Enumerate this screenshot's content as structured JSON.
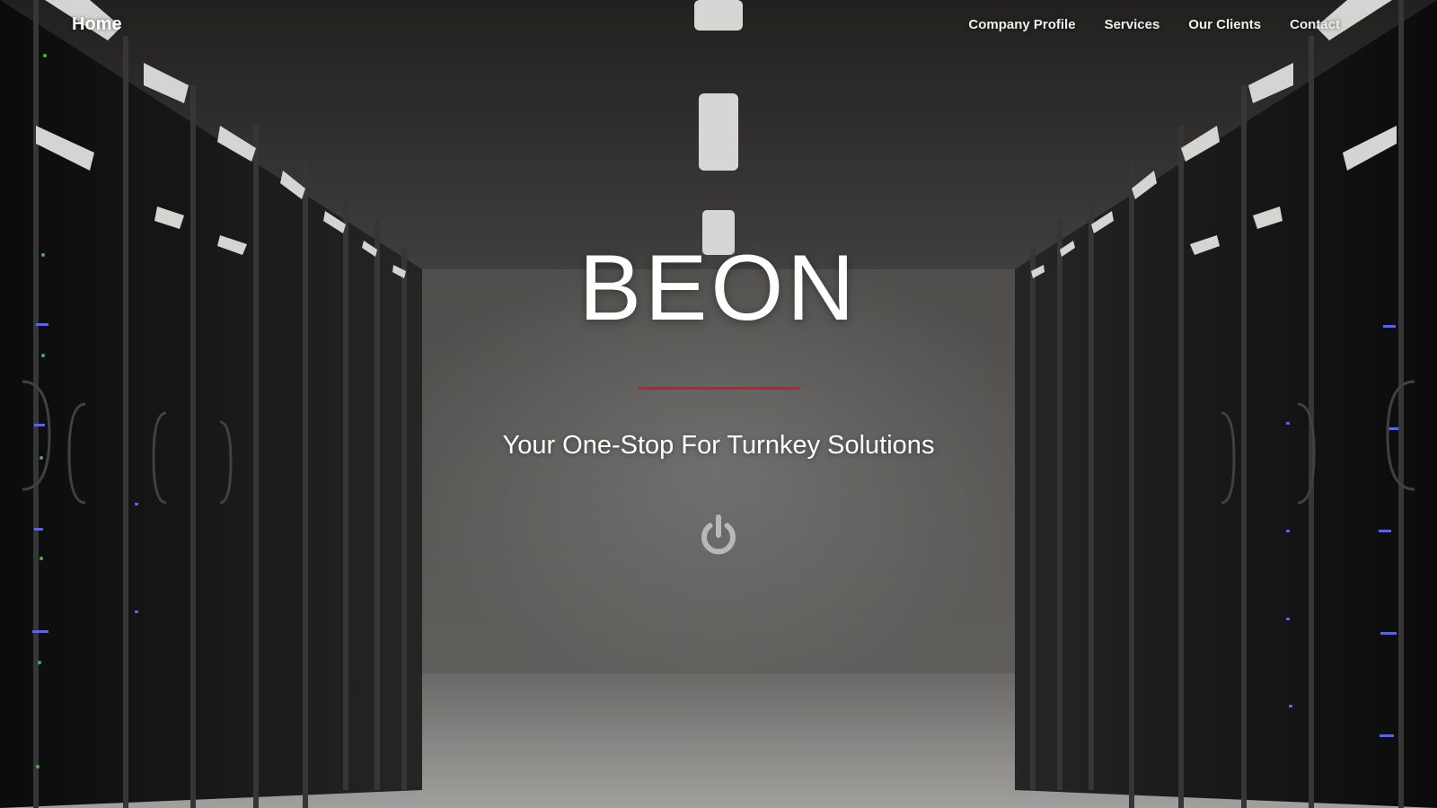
{
  "site": {
    "home_label": "Home"
  },
  "nav": {
    "items": [
      {
        "label": "Company Profile"
      },
      {
        "label": "Services"
      },
      {
        "label": "Our Clients"
      },
      {
        "label": "Contact"
      }
    ]
  },
  "hero": {
    "brand": "BEON",
    "tagline": "Your One-Stop For Turnkey Solutions",
    "cta_icon": "power-icon",
    "accent_color": "#c0202e"
  }
}
